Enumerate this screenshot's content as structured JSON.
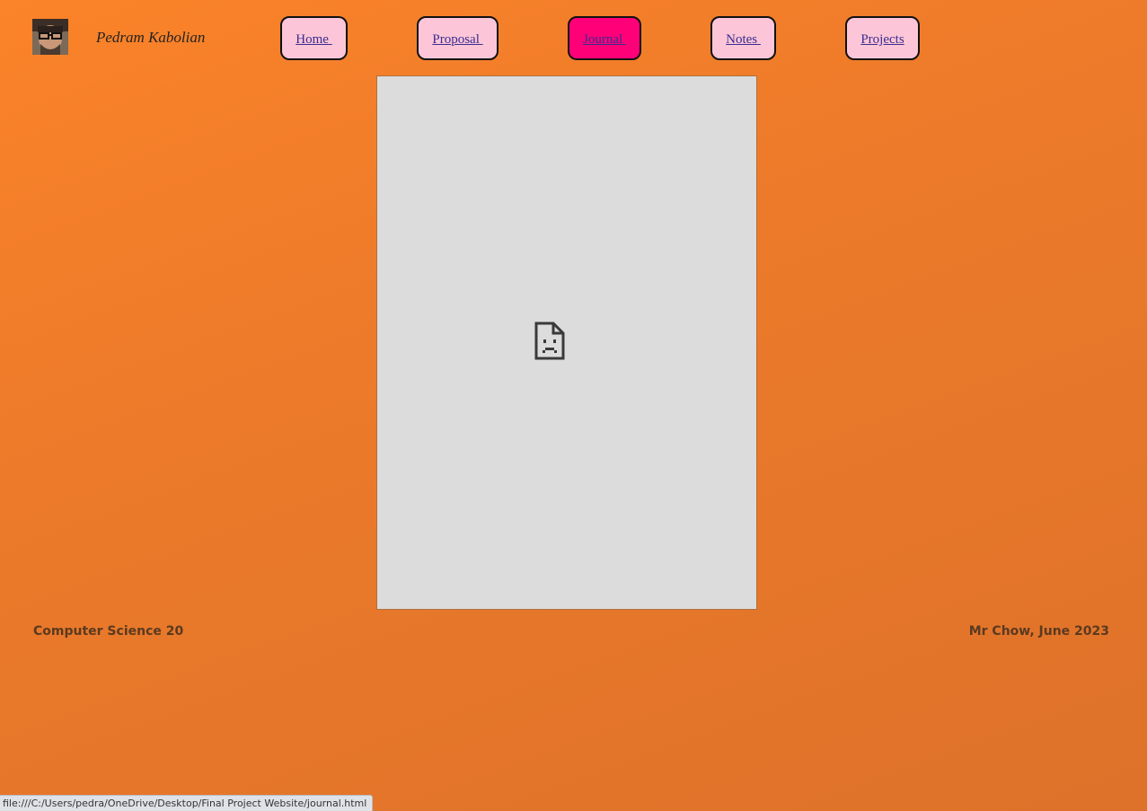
{
  "header": {
    "author_name": "Pedram Kabolian",
    "avatar_icon": "profile-photo"
  },
  "nav": {
    "items": [
      {
        "label": "Home ",
        "active": false
      },
      {
        "label": "Proposal ",
        "active": false
      },
      {
        "label": "Journal ",
        "active": true
      },
      {
        "label": "Notes ",
        "active": false
      },
      {
        "label": "Projects",
        "active": false
      }
    ],
    "button_color": "#fcc6d8",
    "active_color": "#ff0078"
  },
  "content": {
    "frame_state_icon": "broken-page-icon"
  },
  "footer": {
    "left_text": "Computer Science 20",
    "right_text": "Mr Chow, June 2023"
  },
  "status_bar": {
    "url": "file:///C:/Users/pedra/OneDrive/Desktop/Final Project Website/journal.html"
  },
  "colors": {
    "background": "#ec7a2a"
  }
}
